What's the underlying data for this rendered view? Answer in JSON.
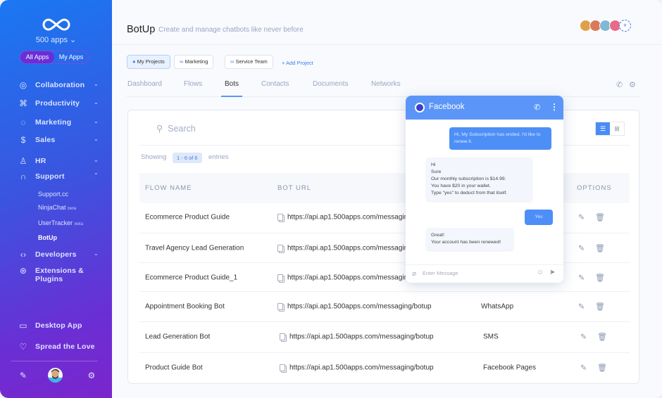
{
  "sidebar": {
    "apps_count": "500 apps",
    "toggle": [
      "All Apps",
      "My Apps"
    ],
    "nav": [
      {
        "label": "Collaboration",
        "icon": "globe-icon"
      },
      {
        "label": "Productivity",
        "icon": "command-icon"
      },
      {
        "label": "Marketing",
        "icon": "target-icon"
      },
      {
        "label": "Sales",
        "icon": "dollar-icon"
      },
      {
        "label": "HR",
        "icon": "user-icon"
      },
      {
        "label": "Support",
        "icon": "headphones-icon"
      },
      {
        "label": "Developers",
        "icon": "code-icon"
      },
      {
        "label": "Extensions &",
        "label2": "Plugins",
        "icon": "chrome-icon"
      }
    ],
    "support_sub": [
      {
        "label": "Support.cc",
        "badge": ""
      },
      {
        "label": "NinjaChat",
        "badge": "Beta"
      },
      {
        "label": "UserTracker",
        "badge": "Beta"
      },
      {
        "label": "BotUp",
        "badge": ""
      }
    ],
    "bottom": [
      {
        "label": "Desktop App",
        "icon": "monitor-icon"
      },
      {
        "label": "Spread the Love",
        "icon": "heart-icon"
      }
    ]
  },
  "header": {
    "title": "BotUp",
    "subtitle": "Create and manage chatbots like never before"
  },
  "projects": {
    "items": [
      "My Projects",
      "Marketing",
      "Service Team"
    ],
    "add": "+ Add Project"
  },
  "tabs": [
    "Dashboard",
    "Flows",
    "Bots",
    "Contacts",
    "Documents",
    "Networks"
  ],
  "table": {
    "search_placeholder": "Search",
    "showing": "Showing",
    "range": "1 - 6 of 6",
    "entries": "entries",
    "columns": [
      "FLOW NAME",
      "BOT URL",
      "OPTIONS"
    ],
    "rows": [
      {
        "name": "Ecommerce Product Guide",
        "url": "https://api.ap1.500apps.com/messaging/botup",
        "channel": ""
      },
      {
        "name": "Travel Agency Lead Generation",
        "url": "https://api.ap1.500apps.com/messaging/botup",
        "channel": ""
      },
      {
        "name": "Ecommerce Product Guide_1",
        "url": "https://api.ap1.500apps.com/messaging/botup",
        "channel": ""
      },
      {
        "name": "Appointment Booking Bot",
        "url": "https://api.ap1.500apps.com/messaging/botup",
        "channel": "WhatsApp"
      },
      {
        "name": "Lead Generation Bot",
        "url": "https://api.ap1.500apps.com/messaging/botup",
        "channel": "SMS"
      },
      {
        "name": "Product Guide Bot",
        "url": "https://api.ap1.500apps.com/messaging/botup",
        "channel": "Facebook Pages"
      }
    ]
  },
  "chat": {
    "title": "Facebook",
    "placeholder": "Enter Message",
    "messages": [
      {
        "dir": "out",
        "text": "Hi, My Subscription has ended. I'd like to renew it."
      },
      {
        "dir": "in",
        "lines": [
          "Hi",
          "Sure",
          "Our monthly subscription is $14.99.",
          "You have $20 in your wallet.",
          "Type \"yes\" to deduct from that itself."
        ]
      },
      {
        "dir": "out",
        "text": "Yes"
      },
      {
        "dir": "in",
        "lines": [
          "Great!",
          "Your account has been renewed!"
        ]
      }
    ]
  },
  "colors": {
    "accent": "#5b95f7",
    "sidebar_start": "#1a78f2",
    "sidebar_end": "#7a26cc"
  }
}
